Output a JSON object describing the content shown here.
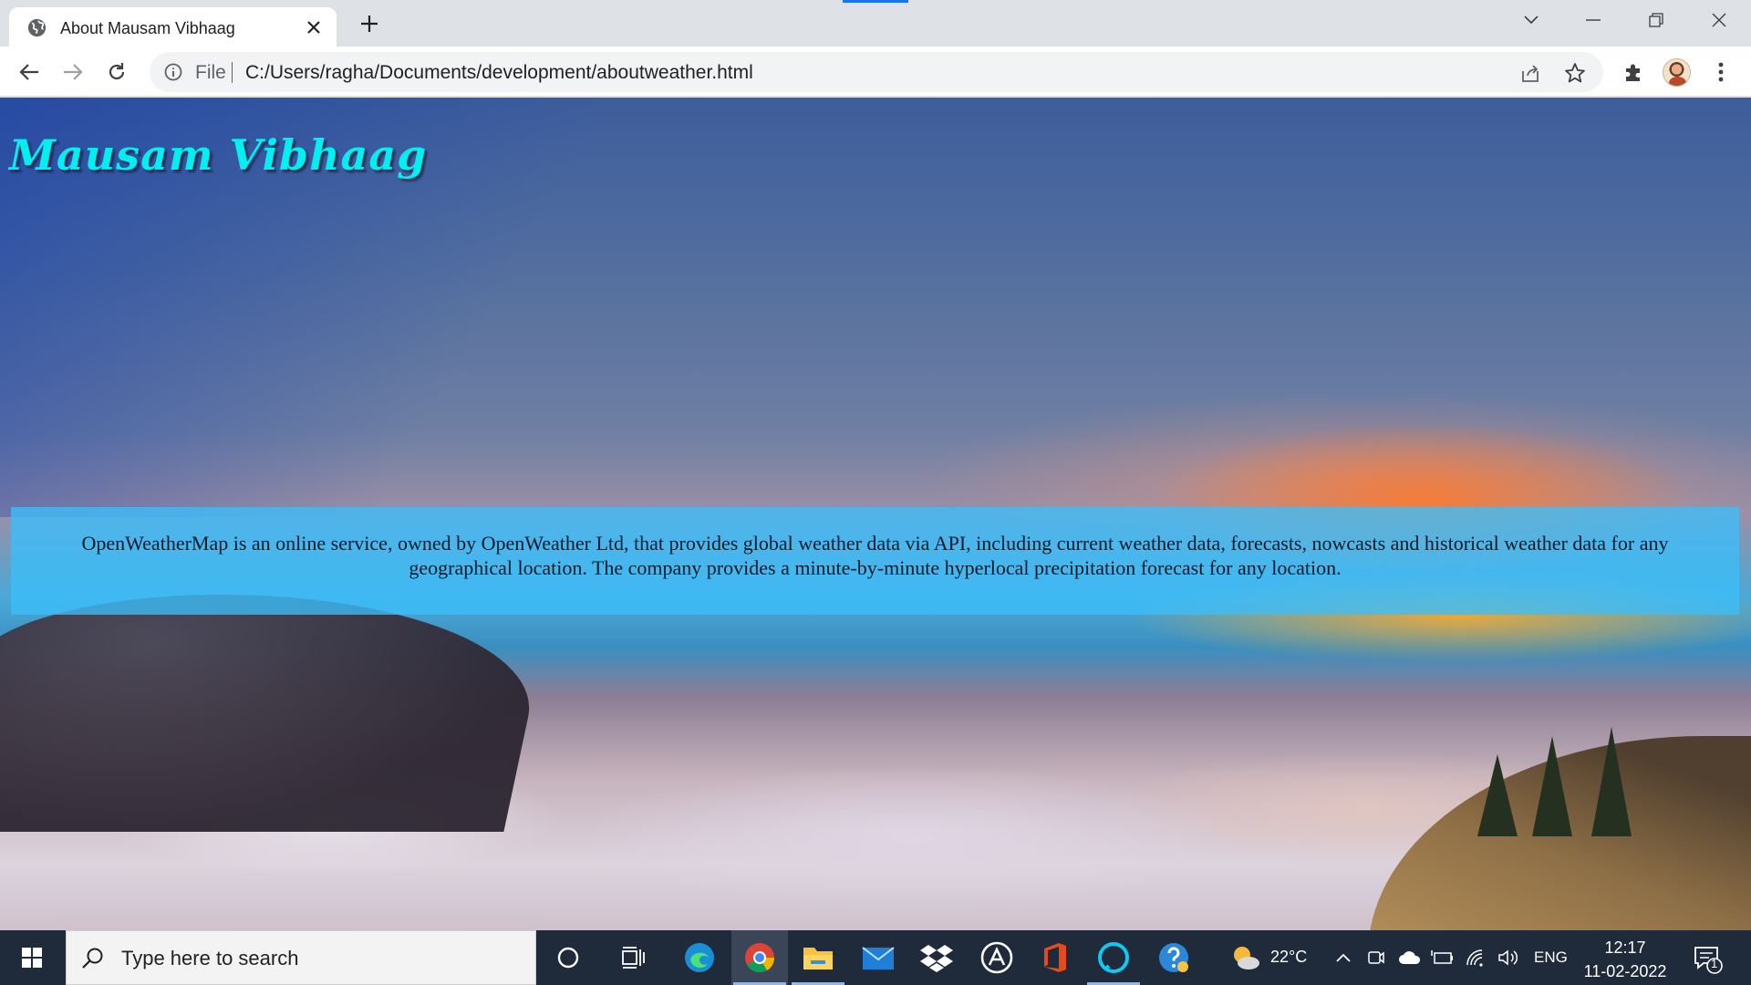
{
  "browser": {
    "tab": {
      "title": "About Mausam Vibhaag"
    },
    "omnibox": {
      "scheme": "File",
      "url": "C:/Users/ragha/Documents/development/aboutweather.html"
    }
  },
  "page": {
    "site_title": "Mausam Vibhaag",
    "about_text": "OpenWeatherMap is an online service, owned by OpenWeather Ltd, that provides global weather data via API, including current weather data, forecasts, nowcasts and historical weather data for any geographical location. The company provides a minute-by-minute hyperlocal precipitation forecast for any location."
  },
  "taskbar": {
    "search_placeholder": "Type here to search",
    "weather": {
      "temperature": "22°C",
      "icon": "partly-sunny-icon"
    },
    "language": "ENG",
    "time": "12:17",
    "date": "11-02-2022",
    "notification_count": "1",
    "pinned_apps": [
      "cortana",
      "task-view",
      "edge",
      "chrome",
      "file-explorer",
      "mail",
      "dropbox",
      "app-launcher",
      "office",
      "alexa",
      "help"
    ]
  },
  "colors": {
    "title_color": "#00f0f0",
    "about_box_bg": "#3cbefa",
    "taskbar_bg": "#1f2a3a",
    "tab_strip_bg": "#dee1e6"
  }
}
